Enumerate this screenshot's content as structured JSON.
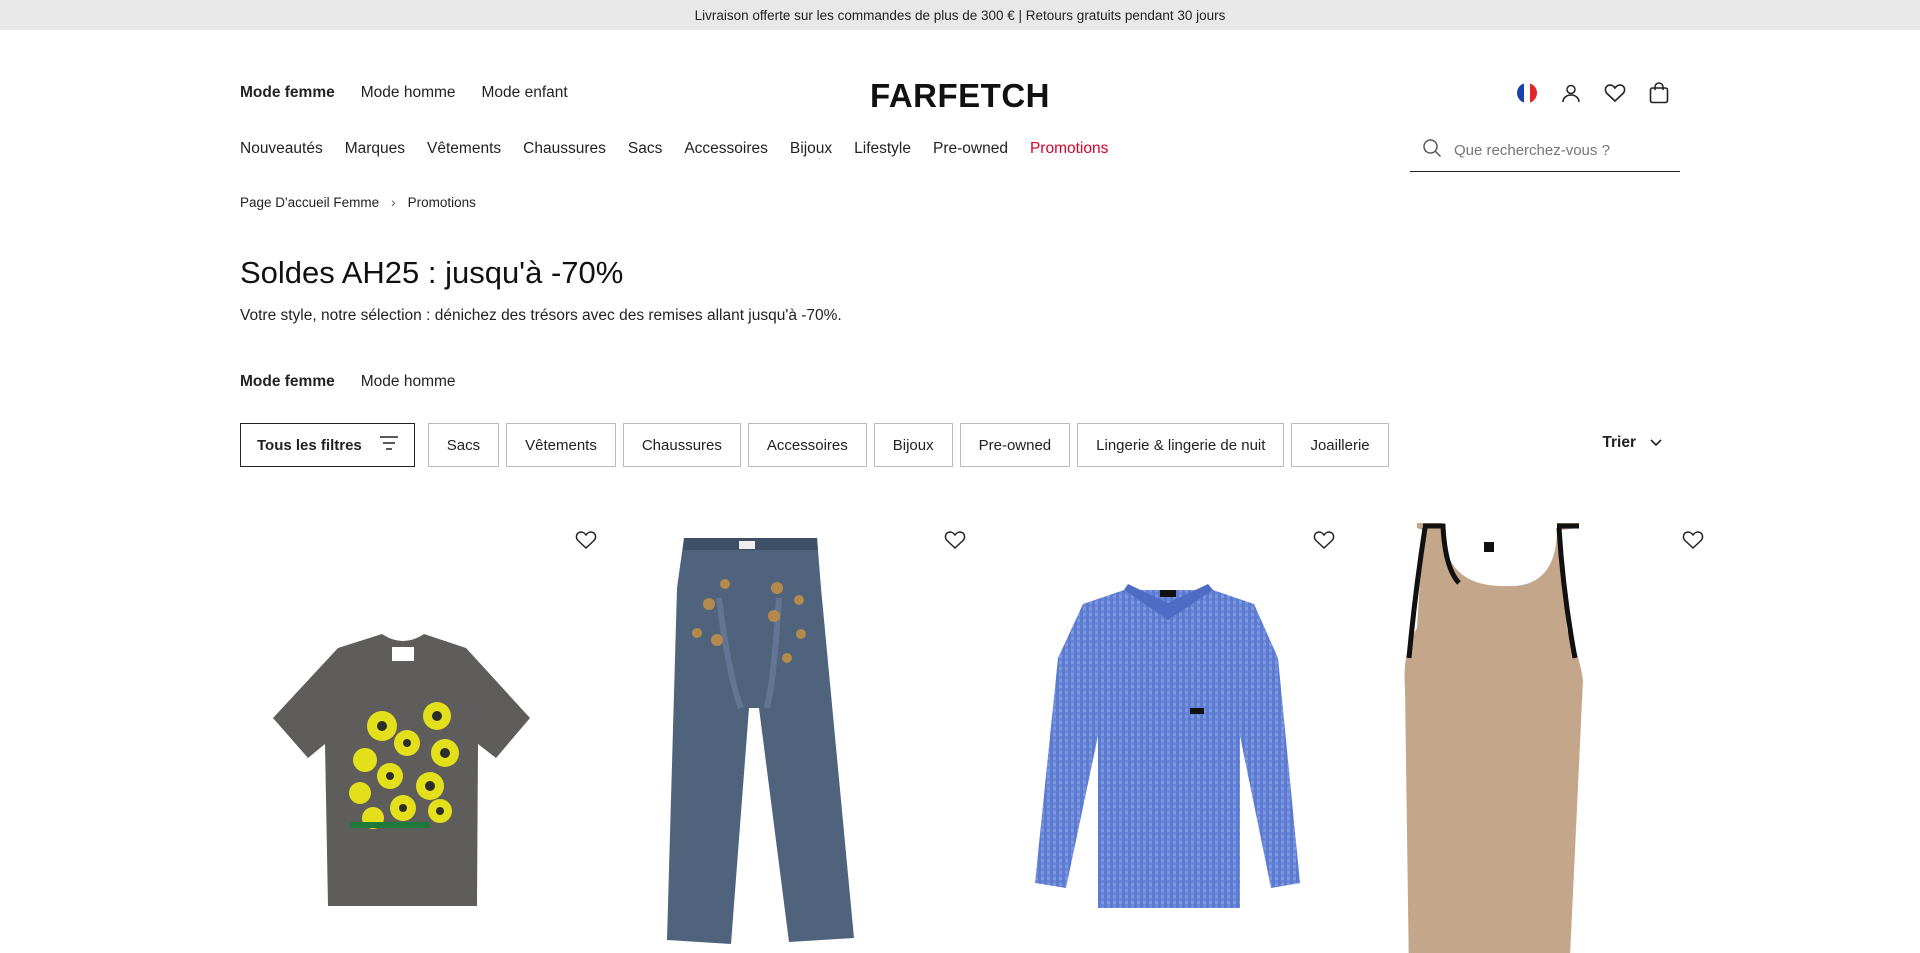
{
  "promo_bar": {
    "text": "Livraison offerte sur les commandes de plus de 300 € | Retours gratuits pendant 30 jours"
  },
  "header": {
    "gender_nav": [
      "Mode femme",
      "Mode homme",
      "Mode enfant"
    ],
    "logo": "FARFETCH",
    "icons": [
      "france-flag-icon",
      "account-icon",
      "wishlist-heart-icon",
      "shopping-bag-icon"
    ]
  },
  "main_nav": [
    "Nouveautés",
    "Marques",
    "Vêtements",
    "Chaussures",
    "Sacs",
    "Accessoires",
    "Bijoux",
    "Lifestyle",
    "Pre-owned",
    "Promotions"
  ],
  "search": {
    "placeholder": "Que recherchez-vous ?"
  },
  "breadcrumb": {
    "home": "Page D'accueil Femme",
    "separator": "›",
    "current": "Promotions"
  },
  "page": {
    "title": "Soldes AH25 : jusqu'à -70%",
    "subtitle": "Votre style, notre sélection : dénichez des trésors avec des remises allant jusqu'à -70%."
  },
  "gender_tabs": [
    "Mode femme",
    "Mode homme"
  ],
  "filters": {
    "all_label": "Tous les filtres",
    "chips": [
      "Sacs",
      "Vêtements",
      "Chaussures",
      "Accessoires",
      "Bijoux",
      "Pre-owned",
      "Lingerie & lingerie de nuit",
      "Joaillerie"
    ]
  },
  "sort": {
    "label": "Trier"
  },
  "products": [
    {
      "item": "grey-tshirt-yellow-flowers"
    },
    {
      "item": "wide-leg-jeans-embellished"
    },
    {
      "item": "blue-gingham-cropped-shirt"
    },
    {
      "item": "beige-halter-dress"
    }
  ],
  "colors": {
    "accent_sale": "#d6002a",
    "text": "#222222",
    "promo_bg": "#e8e8e8"
  }
}
